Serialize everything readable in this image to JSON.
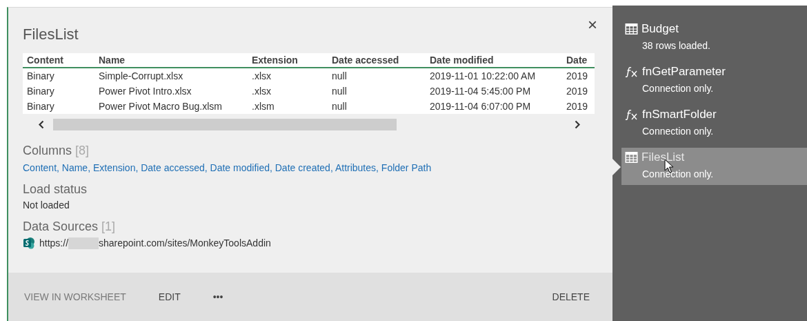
{
  "panel": {
    "title": "FilesList",
    "close": "×",
    "table": {
      "columns": [
        "Content",
        "Name",
        "Extension",
        "Date accessed",
        "Date modified",
        "Date"
      ],
      "rows": [
        [
          "Binary",
          "Simple-Corrupt.xlsx",
          ".xlsx",
          "null",
          "2019-11-01 10:22:00 AM",
          "2019"
        ],
        [
          "Binary",
          "Power Pivot Intro.xlsx",
          ".xlsx",
          "null",
          "2019-11-04 5:45:00 PM",
          "2019"
        ],
        [
          "Binary",
          "Power Pivot Macro Bug.xlsm",
          ".xlsm",
          "null",
          "2019-11-04 6:07:00 PM",
          "2019"
        ]
      ]
    },
    "columns_section": {
      "heading": "Columns",
      "count": "[8]",
      "list": "Content, Name, Extension, Date accessed, Date modified, Date created, Attributes, Folder Path"
    },
    "load_status": {
      "heading": "Load status",
      "value": "Not loaded"
    },
    "data_sources": {
      "heading": "Data Sources",
      "count": "[1]",
      "items": [
        {
          "prefix": "https://",
          "rest": "sharepoint.com/sites/MonkeyToolsAddin"
        }
      ]
    },
    "actions": [
      {
        "label": "VIEW IN WORKSHEET",
        "disabled": true
      },
      {
        "label": "EDIT",
        "disabled": false
      },
      {
        "label": "•••",
        "disabled": false
      }
    ],
    "right_actions": [
      {
        "label": "DELETE",
        "disabled": false
      }
    ]
  },
  "queries": [
    {
      "name": "Budget",
      "kind": "table",
      "status": "38 rows loaded.",
      "selected": false
    },
    {
      "name": "fnGetParameter",
      "kind": "function",
      "status": "Connection only.",
      "selected": false
    },
    {
      "name": "fnSmartFolder",
      "kind": "function",
      "status": "Connection only.",
      "selected": false
    },
    {
      "name": "FilesList",
      "kind": "table",
      "status": "Connection only.",
      "selected": true
    }
  ]
}
